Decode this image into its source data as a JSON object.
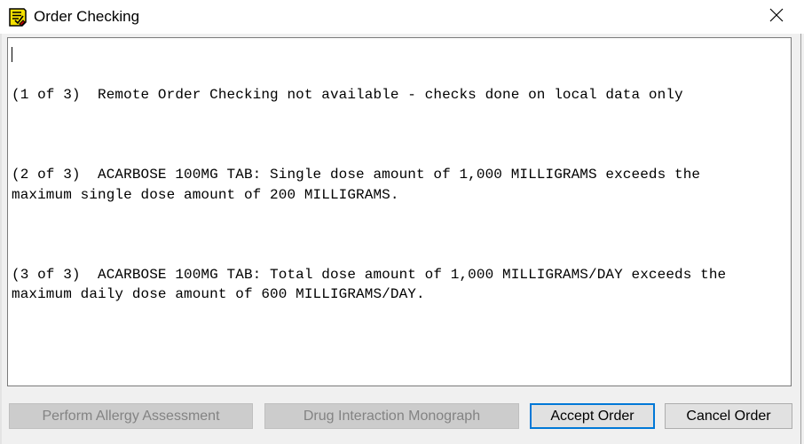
{
  "window": {
    "title": "Order Checking",
    "icon": "order-checking-app-icon",
    "close_icon": "close-icon"
  },
  "memo": {
    "paragraphs": [
      "(1 of 3)  Remote Order Checking not available - checks done on local data only",
      "(2 of 3)  ACARBOSE 100MG TAB: Single dose amount of 1,000 MILLIGRAMS exceeds the\nmaximum single dose amount of 200 MILLIGRAMS.",
      "(3 of 3)  ACARBOSE 100MG TAB: Total dose amount of 1,000 MILLIGRAMS/DAY exceeds the\nmaximum daily dose amount of 600 MILLIGRAMS/DAY."
    ]
  },
  "buttons": {
    "perform_allergy_assessment": "Perform Allergy Assessment",
    "drug_interaction_monograph": "Drug Interaction Monograph",
    "accept_order": "Accept Order",
    "cancel_order": "Cancel Order"
  },
  "colors": {
    "default_button_border": "#0078d7",
    "disabled_text": "#838383"
  }
}
